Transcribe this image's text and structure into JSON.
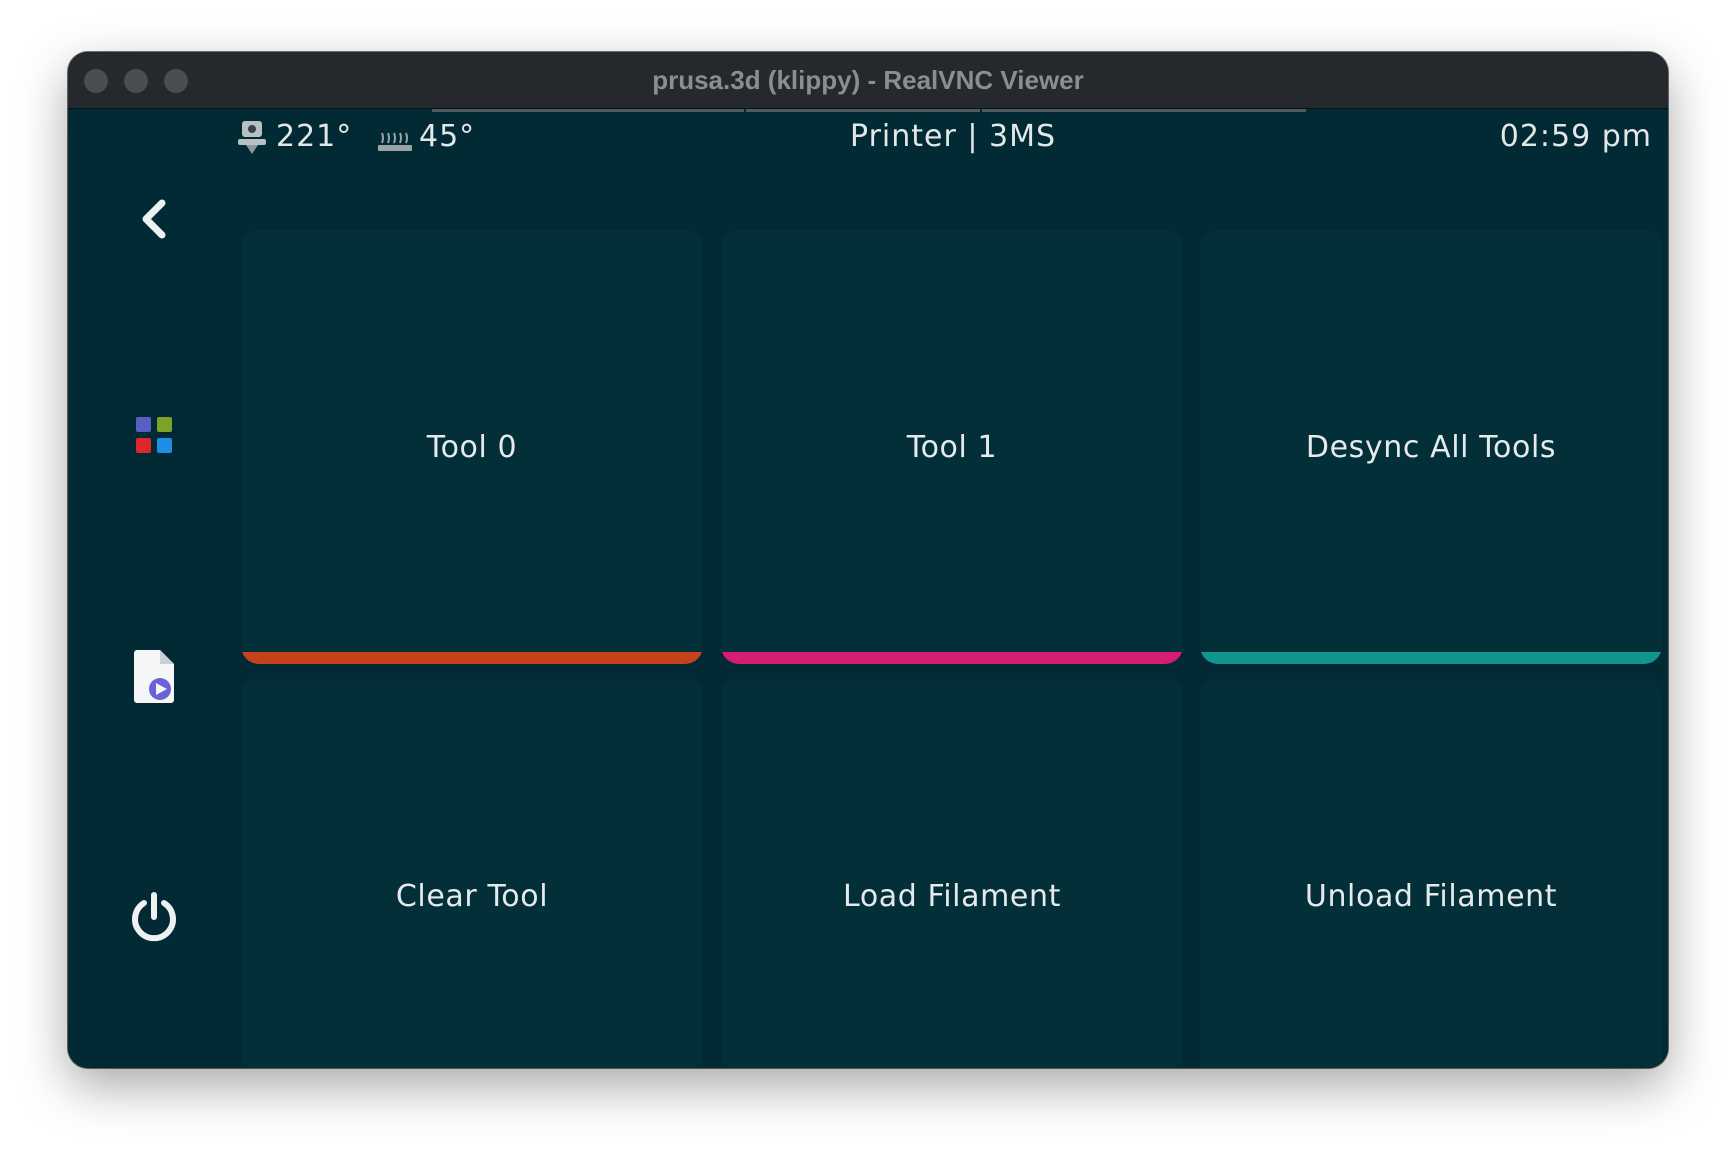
{
  "window": {
    "title": "prusa.3d (klippy) - RealVNC Viewer"
  },
  "status": {
    "extruder_icon": "extruder-icon",
    "extruder_temp": "221°",
    "bed_icon": "heated-bed-icon",
    "bed_temp": "45°",
    "printer_name": "Printer | 3MS",
    "time": "02:59 pm"
  },
  "sidebar": {
    "items": [
      {
        "icon": "back-arrow-icon"
      },
      {
        "icon": "main-menu-grid-icon"
      },
      {
        "icon": "print-file-icon"
      },
      {
        "icon": "power-icon"
      }
    ]
  },
  "grid": {
    "tiles": [
      {
        "label": "Tool 0",
        "accent": "#c7421c"
      },
      {
        "label": "Tool 1",
        "accent": "#d51e72"
      },
      {
        "label": "Desync All Tools",
        "accent": "#10958f"
      },
      {
        "label": "Clear Tool",
        "accent": "#8aa31c"
      },
      {
        "label": "Load Filament",
        "accent": "#c7421c"
      },
      {
        "label": "Unload Filament",
        "accent": "#d51e72"
      }
    ]
  },
  "colors": {
    "background": "#022a34",
    "tile": "#032f39",
    "text": "#e3e7e8"
  }
}
